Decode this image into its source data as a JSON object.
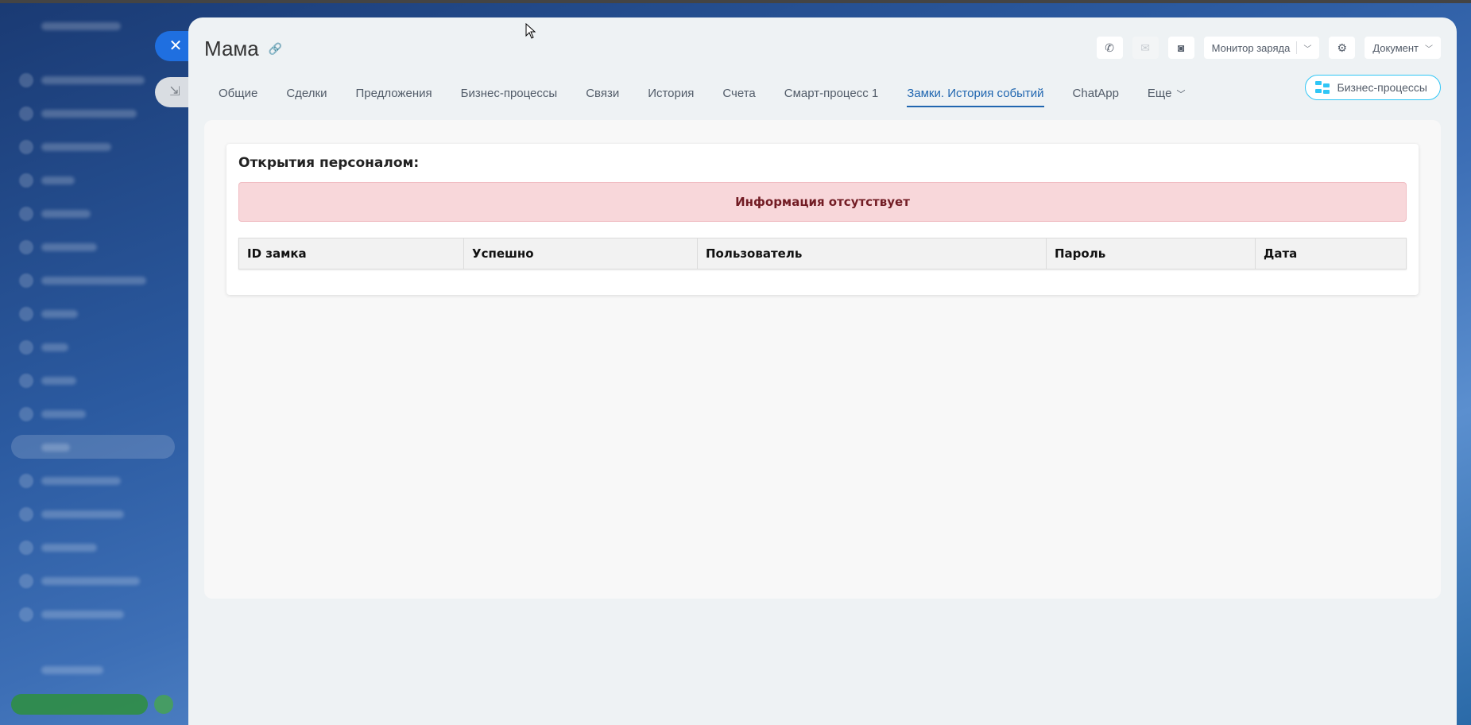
{
  "window": {
    "title": "Мама"
  },
  "top_actions": {
    "monitor_label": "Монитор заряда",
    "document_label": "Документ"
  },
  "tabs": [
    {
      "label": "Общие",
      "active": false
    },
    {
      "label": "Сделки",
      "active": false
    },
    {
      "label": "Предложения",
      "active": false
    },
    {
      "label": "Бизнес-процессы",
      "active": false
    },
    {
      "label": "Связи",
      "active": false
    },
    {
      "label": "История",
      "active": false
    },
    {
      "label": "Счета",
      "active": false
    },
    {
      "label": "Смарт-процесс 1",
      "active": false
    },
    {
      "label": "Замки. История событий",
      "active": true
    },
    {
      "label": "ChatApp",
      "active": false
    },
    {
      "label": "Еще",
      "active": false
    }
  ],
  "bp_button": {
    "label": "Бизнес-процессы"
  },
  "card": {
    "title": "Открытия персоналом:",
    "alert": "Информация отсутствует",
    "columns": [
      "ID замка",
      "Успешно",
      "Пользователь",
      "Пароль",
      "Дата"
    ]
  },
  "colors": {
    "accent": "#2066b0",
    "alert_bg": "#f8d7da",
    "alert_text": "#721c24",
    "bp_border": "#2fc6f6"
  }
}
